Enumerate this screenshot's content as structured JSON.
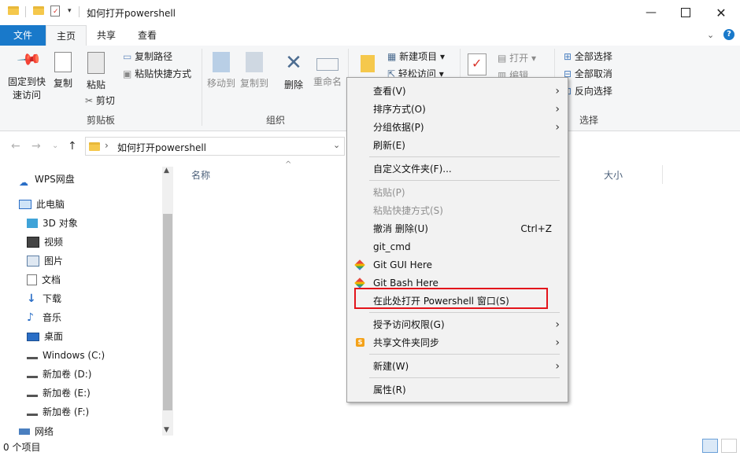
{
  "title": "如何打开powershell",
  "tabs": [
    "文件",
    "主页",
    "共享",
    "查看"
  ],
  "ribbon": {
    "clipboard": {
      "pin": "固定到快速访问",
      "copy": "复制",
      "paste": "粘贴",
      "copy_path": "复制路径",
      "paste_shortcut": "粘贴快捷方式",
      "cut": "剪切",
      "group": "剪贴板"
    },
    "organize": {
      "move_to": "移动到",
      "copy_to": "复制到",
      "delete": "删除",
      "rename": "重命名",
      "group": "组织"
    },
    "new": {
      "new_item": "新建项目",
      "easy_access": "轻松访问"
    },
    "open": {
      "open": "打开",
      "edit": "编辑"
    },
    "select": {
      "select_all": "全部选择",
      "select_none": "全部取消",
      "invert": "反向选择",
      "group": "选择"
    }
  },
  "address": {
    "path": "如何打开powershell"
  },
  "columns": {
    "name": "名称",
    "size": "大小"
  },
  "nav": [
    {
      "label": "WPS网盘",
      "icon": "cloud-icon"
    },
    {
      "label": "此电脑",
      "icon": "computer-icon"
    },
    {
      "label": "3D 对象",
      "icon": "cube-icon"
    },
    {
      "label": "视频",
      "icon": "video-icon"
    },
    {
      "label": "图片",
      "icon": "picture-icon"
    },
    {
      "label": "文档",
      "icon": "document-icon"
    },
    {
      "label": "下载",
      "icon": "download-icon"
    },
    {
      "label": "音乐",
      "icon": "music-icon"
    },
    {
      "label": "桌面",
      "icon": "desktop-icon"
    },
    {
      "label": "Windows (C:)",
      "icon": "drive-icon"
    },
    {
      "label": "新加卷 (D:)",
      "icon": "drive-icon"
    },
    {
      "label": "新加卷 (E:)",
      "icon": "drive-icon"
    },
    {
      "label": "新加卷 (F:)",
      "icon": "drive-icon"
    },
    {
      "label": "网络",
      "icon": "network-icon"
    }
  ],
  "context_menu": [
    {
      "label": "查看(V)",
      "submenu": true
    },
    {
      "label": "排序方式(O)",
      "submenu": true
    },
    {
      "label": "分组依据(P)",
      "submenu": true
    },
    {
      "label": "刷新(E)"
    },
    {
      "label": "自定义文件夹(F)..."
    },
    {
      "label": "粘贴(P)",
      "disabled": true
    },
    {
      "label": "粘贴快捷方式(S)",
      "disabled": true
    },
    {
      "label": "撤消 删除(U)",
      "shortcut": "Ctrl+Z"
    },
    {
      "label": "git_cmd"
    },
    {
      "label": "Git GUI Here",
      "icon": "git-icon"
    },
    {
      "label": "Git Bash Here",
      "icon": "git-icon"
    },
    {
      "label": "在此处打开 Powershell 窗口(S)"
    },
    {
      "label": "授予访问权限(G)",
      "submenu": true
    },
    {
      "label": "共享文件夹同步",
      "submenu": true,
      "icon": "sync-icon"
    },
    {
      "label": "新建(W)",
      "submenu": true
    },
    {
      "label": "属性(R)"
    }
  ],
  "status": {
    "count": "0 个项目"
  },
  "colors": {
    "accent": "#1979ca",
    "highlight": "#e3141b",
    "folder": "#f5c84c"
  }
}
